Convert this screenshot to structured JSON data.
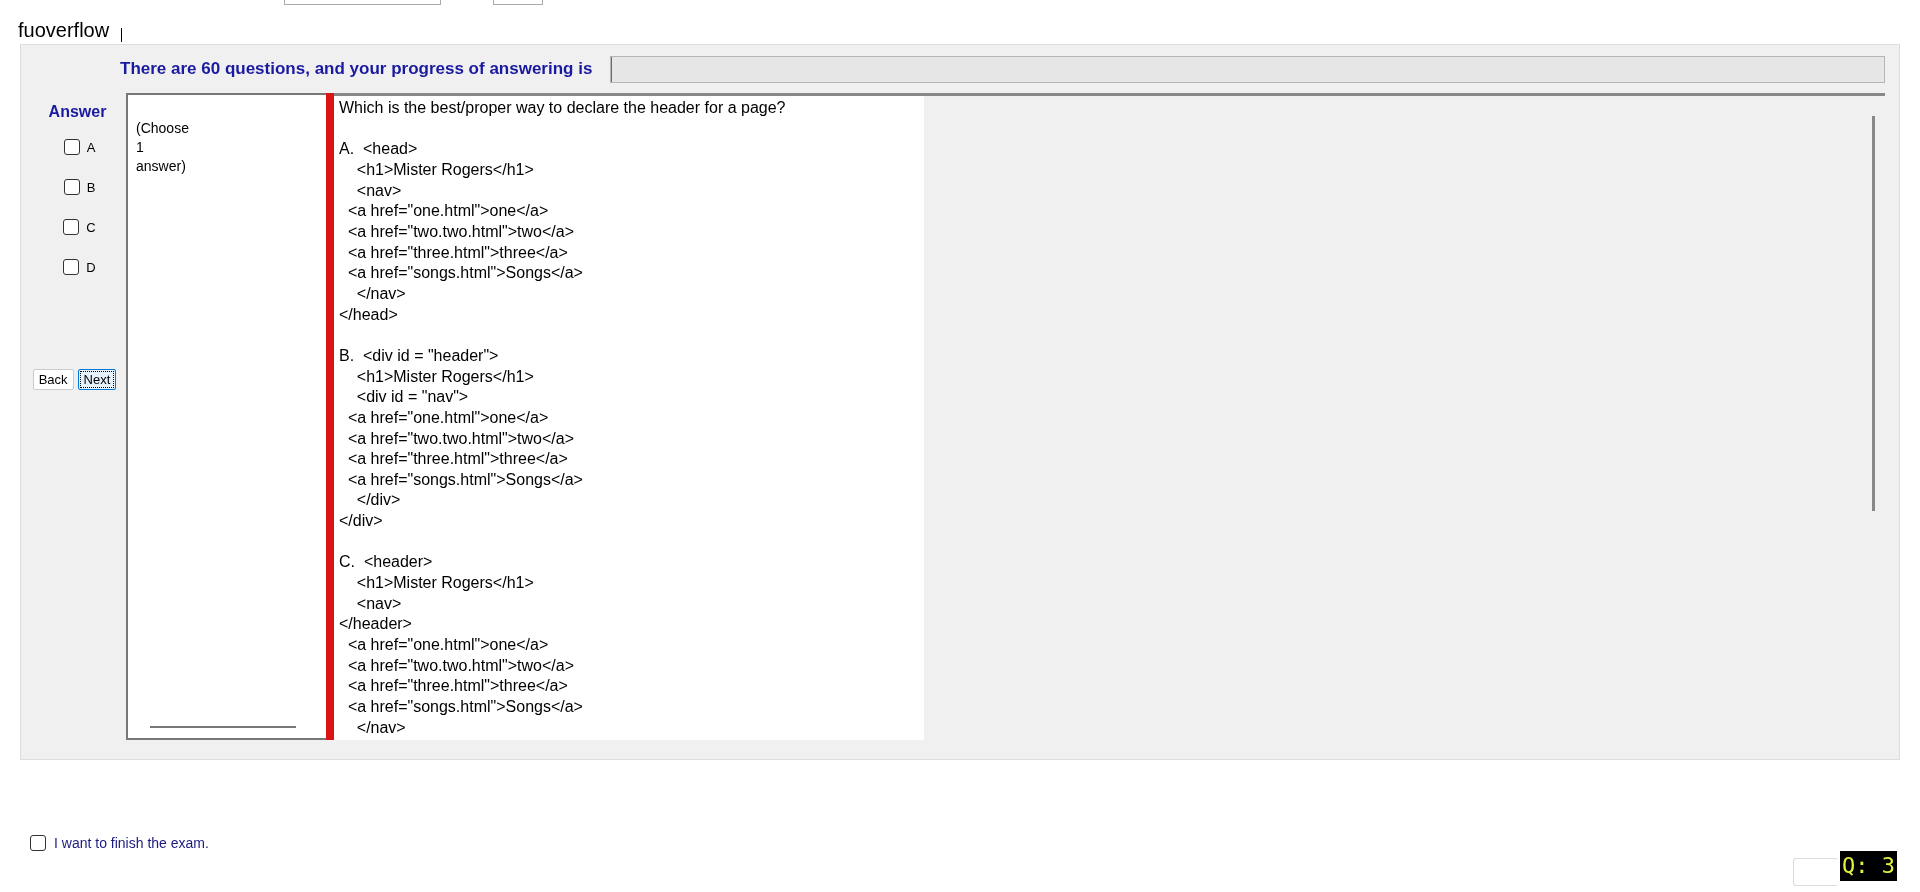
{
  "brand": "fuoverflow",
  "progress": {
    "label": "There are 60 questions, and your progress of answering is",
    "level": 0
  },
  "answer": {
    "title": "Answer",
    "options": [
      {
        "label": "A",
        "checked": false
      },
      {
        "label": "B",
        "checked": false
      },
      {
        "label": "C",
        "checked": false
      },
      {
        "label": "D",
        "checked": false
      }
    ]
  },
  "buttons": [
    {
      "label": "Back",
      "focused": false
    },
    {
      "label": "Next",
      "focused": true
    }
  ],
  "instruction": "(Choose\n1\nanswer)",
  "question": "Which is the best/proper way to declare the header for a page?\n\nA.  <head>\n    <h1>Mister Rogers</h1>\n    <nav>\n  <a href=\"one.html\">one</a>\n  <a href=\"two.two.html\">two</a>\n  <a href=\"three.html\">three</a>\n  <a href=\"songs.html\">Songs</a>\n    </nav>\n</head>\n\nB.  <div id = \"header\">\n    <h1>Mister Rogers</h1>\n    <div id = \"nav\">\n  <a href=\"one.html\">one</a>\n  <a href=\"two.two.html\">two</a>\n  <a href=\"three.html\">three</a>\n  <a href=\"songs.html\">Songs</a>\n    </div>\n</div>\n\nC.  <header>\n    <h1>Mister Rogers</h1>\n    <nav>\n</header>\n  <a href=\"one.html\">one</a>\n  <a href=\"two.two.html\">two</a>\n  <a href=\"three.html\">three</a>\n  <a href=\"songs.html\">Songs</a>\n    </nav>",
  "finish": {
    "label": "I want to finish the exam.",
    "checked": false
  },
  "question_badge": "Q: 3"
}
